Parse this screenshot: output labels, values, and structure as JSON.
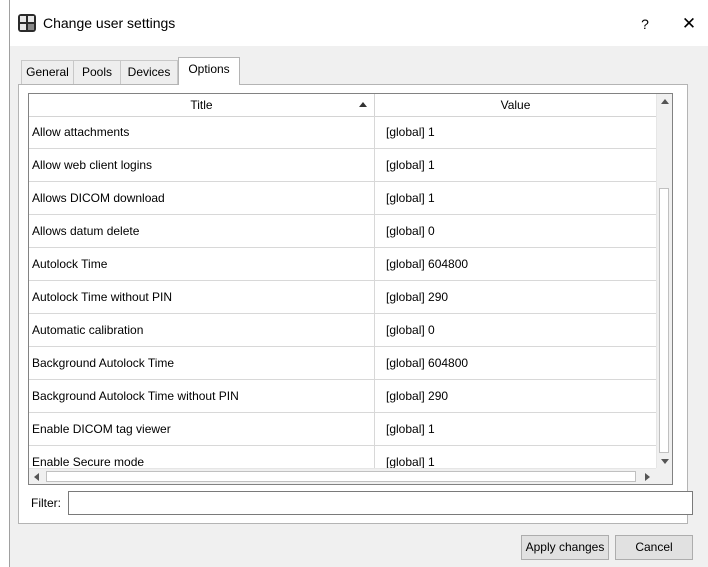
{
  "window": {
    "title": "Change user settings",
    "help_label": "?",
    "close_label": "✕"
  },
  "tabs": [
    {
      "label": "General",
      "active": false
    },
    {
      "label": "Pools",
      "active": false
    },
    {
      "label": "Devices",
      "active": false
    },
    {
      "label": "Options",
      "active": true
    }
  ],
  "table": {
    "columns": [
      "Title",
      "Value"
    ],
    "sort_column": "Title",
    "sort_direction": "ascending",
    "rows": [
      {
        "title": "Allow attachments",
        "value": "[global] 1"
      },
      {
        "title": "Allow web client logins",
        "value": "[global] 1"
      },
      {
        "title": "Allows DICOM download",
        "value": "[global] 1"
      },
      {
        "title": "Allows datum delete",
        "value": "[global] 0"
      },
      {
        "title": "Autolock Time",
        "value": "[global] 604800"
      },
      {
        "title": "Autolock Time without PIN",
        "value": "[global] 290"
      },
      {
        "title": "Automatic calibration",
        "value": "[global] 0"
      },
      {
        "title": "Background Autolock Time",
        "value": "[global] 604800"
      },
      {
        "title": "Background Autolock Time without PIN",
        "value": "[global] 290"
      },
      {
        "title": "Enable DICOM tag viewer",
        "value": "[global] 1"
      },
      {
        "title": "Enable Secure mode",
        "value": "[global] 1"
      }
    ]
  },
  "filter": {
    "label": "Filter:",
    "value": "",
    "placeholder": ""
  },
  "buttons": {
    "apply": "Apply changes",
    "cancel": "Cancel"
  }
}
